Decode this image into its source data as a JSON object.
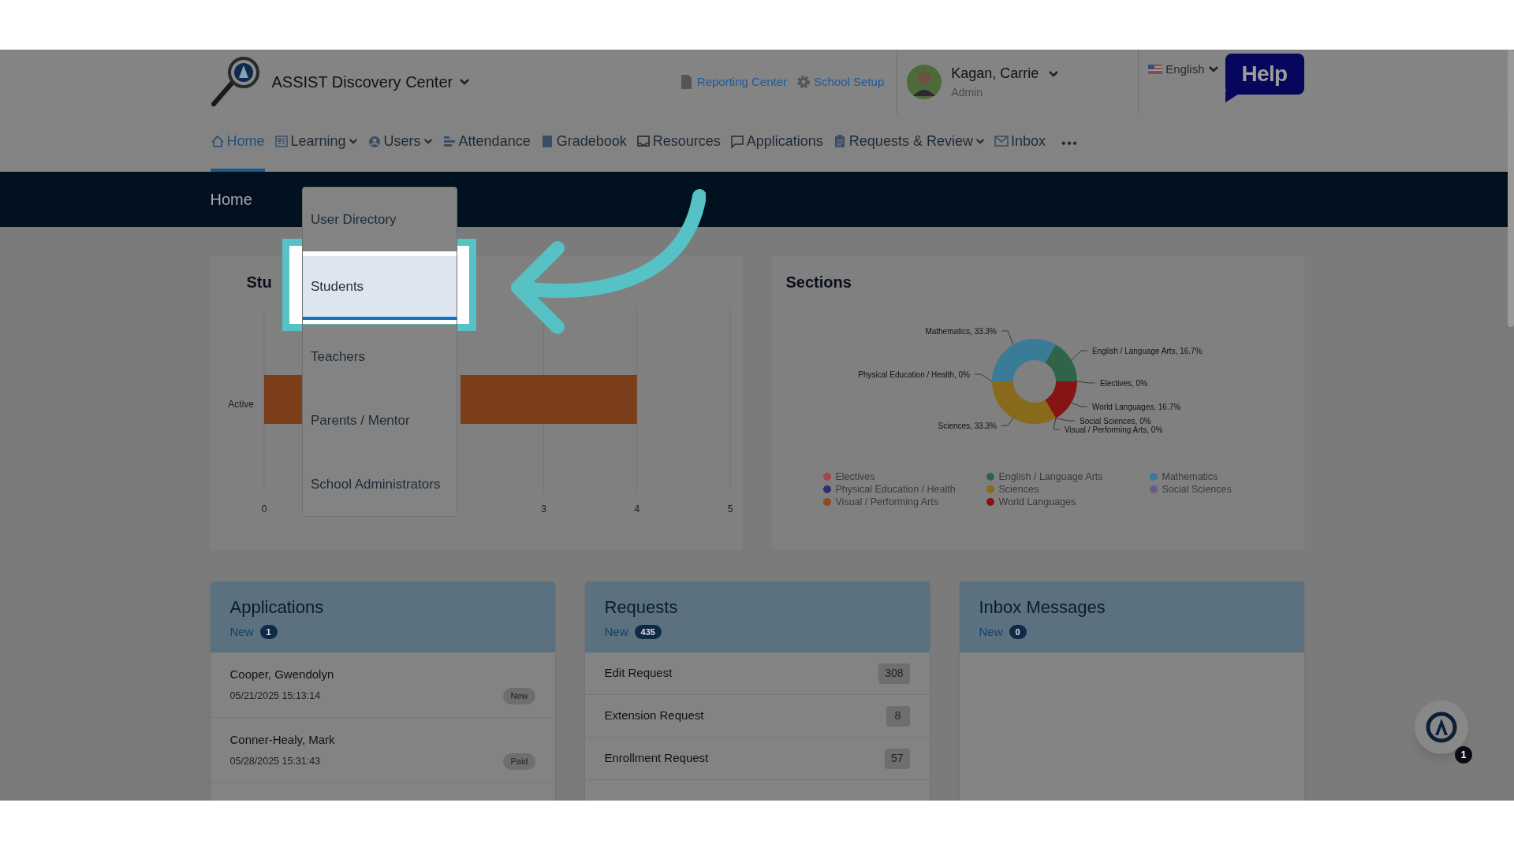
{
  "header": {
    "app_title": "ASSIST Discovery Center",
    "links": [
      {
        "label": "Reporting Center",
        "kind": "document"
      },
      {
        "label": "School Setup",
        "kind": "gear"
      }
    ],
    "user": {
      "name": "Kagan, Carrie",
      "role": "Admin"
    },
    "language": "English",
    "help": "Help"
  },
  "nav": [
    {
      "label": "Home",
      "kind": "house",
      "selected": true,
      "dropdown": false
    },
    {
      "label": "Learning",
      "kind": "grid",
      "selected": false,
      "dropdown": true
    },
    {
      "label": "Users",
      "kind": "user",
      "selected": false,
      "dropdown": true
    },
    {
      "label": "Attendance",
      "kind": "bars",
      "selected": false,
      "dropdown": false
    },
    {
      "label": "Gradebook",
      "kind": "book",
      "selected": false,
      "dropdown": false
    },
    {
      "label": "Resources",
      "kind": "tray",
      "selected": false,
      "dropdown": false
    },
    {
      "label": "Applications",
      "kind": "bubble",
      "selected": false,
      "dropdown": false
    },
    {
      "label": "Requests & Review",
      "kind": "clipboard",
      "selected": false,
      "dropdown": true
    },
    {
      "label": "Inbox",
      "kind": "envelope",
      "selected": false,
      "dropdown": false
    }
  ],
  "nav_more": "•••",
  "banner": {
    "title": "Home"
  },
  "users_menu": {
    "items": [
      {
        "label": "User Directory",
        "selected": false
      },
      {
        "label": "Students",
        "selected": true
      },
      {
        "label": "Teachers",
        "selected": false
      },
      {
        "label": "Parents / Mentor",
        "selected": false
      },
      {
        "label": "School Administrators",
        "selected": false
      }
    ]
  },
  "students_card": {
    "title": "Stu",
    "chart_data": {
      "type": "bar",
      "orientation": "horizontal",
      "categories": [
        "Active"
      ],
      "values": [
        4
      ],
      "xlim": [
        0,
        5
      ],
      "xticks": [
        0,
        3,
        4,
        5
      ]
    }
  },
  "sections_card": {
    "title": "Sections",
    "chart_data": {
      "type": "donut",
      "categories": [
        "Electives",
        "English / Language Arts",
        "Mathematics",
        "Physical Education / Health",
        "Sciences",
        "Social Sciences",
        "Visual / Performing Arts",
        "World Languages"
      ],
      "values": [
        0,
        16.7,
        33.3,
        0,
        33.3,
        0,
        0,
        16.7
      ],
      "colors": [
        "#a04848",
        "#2f6448",
        "#3a7c96",
        "#2e2f6c",
        "#886a1c",
        "#6a5a86",
        "#8a4a1e",
        "#861414"
      ],
      "value_labels": [
        "Electives, 0%",
        "English / Language Arts, 16.7%",
        "Mathematics, 33.3%",
        "Physical Education / Health, 0%",
        "Sciences, 33.3%",
        "Social Sciences, 0%",
        "Visual / Performing Arts, 0%",
        "World Languages, 16.7%"
      ]
    }
  },
  "applications": {
    "title": "Applications",
    "new_label": "New",
    "new_count": "1",
    "rows": [
      {
        "name": "Cooper, Gwendolyn",
        "date": "05/21/2025 15:13:14",
        "status": "New"
      },
      {
        "name": "Conner-Healy, Mark",
        "date": "05/28/2025 15:31:43",
        "status": "Paid"
      }
    ]
  },
  "requests": {
    "title": "Requests",
    "new_label": "New",
    "new_count": "435",
    "rows": [
      {
        "label": "Edit Request",
        "count": "308"
      },
      {
        "label": "Extension Request",
        "count": "8"
      },
      {
        "label": "Enrollment Request",
        "count": "57"
      }
    ]
  },
  "inbox": {
    "title": "Inbox Messages",
    "new_label": "New",
    "new_count": "0"
  },
  "chat_badge": "1"
}
